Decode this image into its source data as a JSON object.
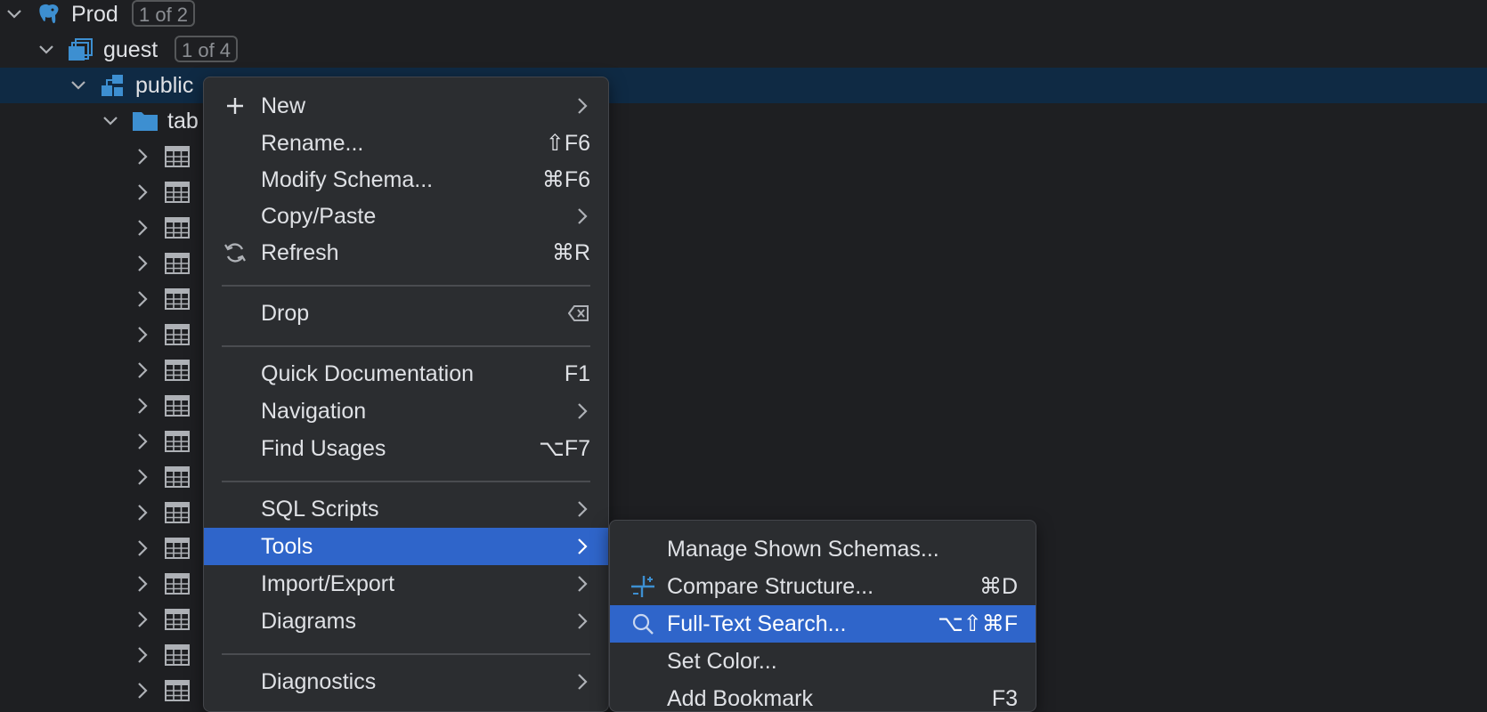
{
  "tree": {
    "prod": {
      "label": "Prod",
      "badge": "1 of 2",
      "icon": "postgresql-elephant-icon"
    },
    "guest": {
      "label": "guest",
      "badge": "1 of 4",
      "icon": "database-icon"
    },
    "public": {
      "label": "public",
      "icon": "schema-icon"
    },
    "tables": {
      "label": "tab",
      "icon": "folder-icon"
    },
    "table_row_icon": "table-icon"
  },
  "context_menu": {
    "items": [
      {
        "label": "New",
        "shortcut": "",
        "icon": "plus-icon",
        "submenu": true
      },
      {
        "label": "Rename...",
        "shortcut": "⇧F6",
        "icon": "",
        "submenu": false
      },
      {
        "label": "Modify Schema...",
        "shortcut": "⌘F6",
        "icon": "",
        "submenu": false
      },
      {
        "label": "Copy/Paste",
        "shortcut": "",
        "icon": "",
        "submenu": true
      },
      {
        "label": "Refresh",
        "shortcut": "⌘R",
        "icon": "refresh-icon",
        "submenu": false
      },
      {
        "label": "Drop",
        "shortcut": "",
        "icon": "",
        "submenu": false,
        "shortcut_icon": "delete-key-icon"
      },
      {
        "label": "Quick Documentation",
        "shortcut": "F1",
        "icon": "",
        "submenu": false
      },
      {
        "label": "Navigation",
        "shortcut": "",
        "icon": "",
        "submenu": true
      },
      {
        "label": "Find Usages",
        "shortcut": "⌥F7",
        "icon": "",
        "submenu": false
      },
      {
        "label": "SQL Scripts",
        "shortcut": "",
        "icon": "",
        "submenu": true
      },
      {
        "label": "Tools",
        "shortcut": "",
        "icon": "",
        "submenu": true,
        "highlighted": true
      },
      {
        "label": "Import/Export",
        "shortcut": "",
        "icon": "",
        "submenu": true
      },
      {
        "label": "Diagrams",
        "shortcut": "",
        "icon": "",
        "submenu": true
      },
      {
        "label": "Diagnostics",
        "shortcut": "",
        "icon": "",
        "submenu": true
      }
    ]
  },
  "tools_submenu": {
    "items": [
      {
        "label": "Manage Shown Schemas...",
        "shortcut": "",
        "icon": ""
      },
      {
        "label": "Compare Structure...",
        "shortcut": "⌘D",
        "icon": "compare-icon"
      },
      {
        "label": "Full-Text Search...",
        "shortcut": "⌥⇧⌘F",
        "icon": "search-icon",
        "highlighted": true
      },
      {
        "label": "Set Color...",
        "shortcut": "",
        "icon": ""
      },
      {
        "label": "Add Bookmark",
        "shortcut": "F3",
        "icon": ""
      }
    ]
  },
  "colors": {
    "background": "#1e1f22",
    "menu_background": "#2b2d30",
    "highlight": "#2f65ca",
    "selected_row": "#0f2a44",
    "accent_icon": "#3d8fd1"
  }
}
